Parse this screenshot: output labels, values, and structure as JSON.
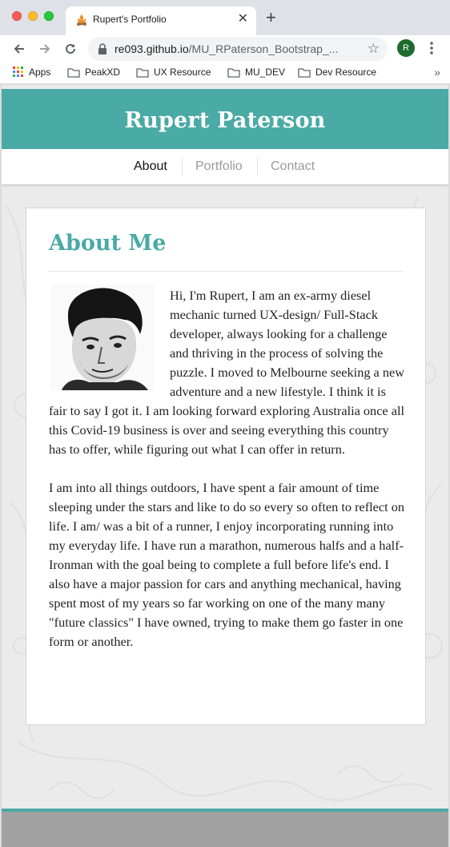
{
  "browser": {
    "tab_title": "Rupert's Portfolio",
    "url_host": "re093.github.io",
    "url_path": "/MU_RPaterson_Bootstrap_...",
    "profile_initial": "R",
    "bookmarks": [
      "Apps",
      "PeakXD",
      "UX Resource",
      "MU_DEV",
      "Dev Resource"
    ],
    "icons": {
      "back": "arrow-left-icon",
      "forward": "arrow-right-icon",
      "reload": "reload-icon",
      "lock": "lock-icon",
      "star": "star-icon",
      "menu": "kebab-menu-icon",
      "folder": "folder-icon",
      "apps": "apps-grid-icon",
      "more": "chevron-double-right-icon"
    }
  },
  "site": {
    "title": "Rupert Paterson",
    "nav": [
      "About",
      "Portfolio",
      "Contact"
    ],
    "active_nav": "About",
    "accent_color": "#4aaaa5"
  },
  "about": {
    "heading": "About Me",
    "paragraphs": [
      "Hi, I'm Rupert, I am an ex-army diesel mechanic turned UX-design/ Full-Stack developer, always looking for a challenge and thriving in the process of solving the puzzle. I moved to Melbourne seeking a new adventure and a new lifestyle. I think it is fair to say I got it. I am looking forward exploring Australia once all this Covid-19 business is over and seeing everything this country has to offer, while figuring out what I can offer in return.",
      "I am into all things outdoors, I have spent a fair amount of time sleeping under the stars and like to do so every so often to reflect on life. I am/ was a bit of a runner, I enjoy incorporating running into my everyday life. I have run a marathon, numerous halfs and a half-Ironman with the goal being to complete a full before life's end. I also have a major passion for cars and anything mechanical, having spent most of my years so far working on one of the many many \"future classics\" I have owned, trying to make them go faster in one form or another."
    ]
  }
}
